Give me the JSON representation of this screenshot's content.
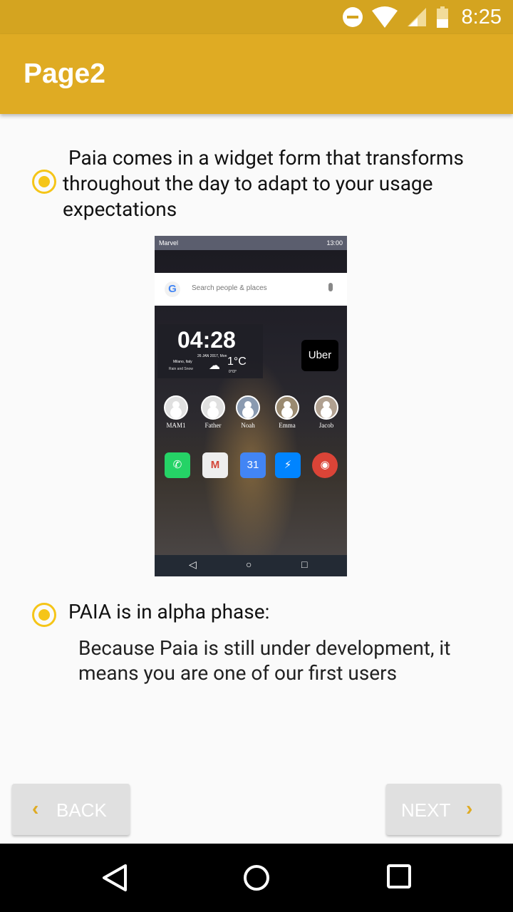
{
  "status_bar": {
    "time": "8:25",
    "icons": [
      "do-not-disturb-icon",
      "wifi-icon",
      "signal-icon",
      "battery-icon"
    ]
  },
  "app_bar": {
    "title": "Page2"
  },
  "item1": {
    "text": "Paia comes in a widget form that transforms throughout the day to adapt to your usage expectations"
  },
  "preview": {
    "carrier": "Marvel",
    "time": "13:00",
    "search_placeholder": "Search people & places",
    "clock": "04:28",
    "date": "26 JAN 2017, Mon",
    "city": "Milano, Italy",
    "condition": "Rain and Snow",
    "temperature": "1°C",
    "minmax": "0°/3°",
    "uber": "Uber",
    "contacts": [
      "MAM1",
      "Father",
      "Noah",
      "Emma",
      "Jacob"
    ],
    "apps": [
      {
        "name": "whatsapp",
        "glyph": "✆",
        "color": "#25d366"
      },
      {
        "name": "gmail",
        "glyph": "M",
        "color": "#e8e8e8"
      },
      {
        "name": "calendar",
        "glyph": "31",
        "color": "#4285f4"
      },
      {
        "name": "messenger",
        "glyph": "⚡",
        "color": "#0084ff"
      },
      {
        "name": "chrome",
        "glyph": "◉",
        "color": "#db4437"
      }
    ]
  },
  "item2": {
    "title": "PAIA is in alpha phase:",
    "body": "Because Paia is still under development, it means you are one of our first users"
  },
  "buttons": {
    "back": "BACK",
    "next": "NEXT"
  }
}
